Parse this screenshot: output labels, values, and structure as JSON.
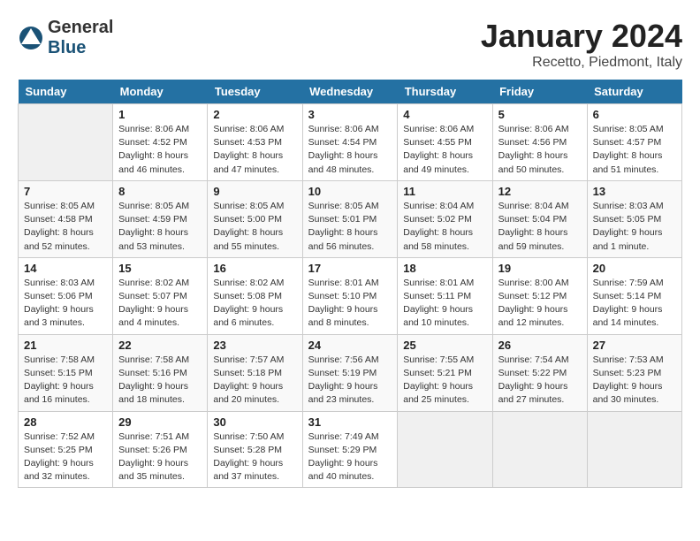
{
  "header": {
    "logo": {
      "general": "General",
      "blue": "Blue"
    },
    "title": "January 2024",
    "subtitle": "Recetto, Piedmont, Italy"
  },
  "days_of_week": [
    "Sunday",
    "Monday",
    "Tuesday",
    "Wednesday",
    "Thursday",
    "Friday",
    "Saturday"
  ],
  "weeks": [
    [
      {
        "day": null,
        "empty": true
      },
      {
        "day": 1,
        "sunrise": "8:06 AM",
        "sunset": "4:52 PM",
        "daylight": "8 hours and 46 minutes."
      },
      {
        "day": 2,
        "sunrise": "8:06 AM",
        "sunset": "4:53 PM",
        "daylight": "8 hours and 47 minutes."
      },
      {
        "day": 3,
        "sunrise": "8:06 AM",
        "sunset": "4:54 PM",
        "daylight": "8 hours and 48 minutes."
      },
      {
        "day": 4,
        "sunrise": "8:06 AM",
        "sunset": "4:55 PM",
        "daylight": "8 hours and 49 minutes."
      },
      {
        "day": 5,
        "sunrise": "8:06 AM",
        "sunset": "4:56 PM",
        "daylight": "8 hours and 50 minutes."
      },
      {
        "day": 6,
        "sunrise": "8:05 AM",
        "sunset": "4:57 PM",
        "daylight": "8 hours and 51 minutes."
      }
    ],
    [
      {
        "day": 7,
        "sunrise": "8:05 AM",
        "sunset": "4:58 PM",
        "daylight": "8 hours and 52 minutes."
      },
      {
        "day": 8,
        "sunrise": "8:05 AM",
        "sunset": "4:59 PM",
        "daylight": "8 hours and 53 minutes."
      },
      {
        "day": 9,
        "sunrise": "8:05 AM",
        "sunset": "5:00 PM",
        "daylight": "8 hours and 55 minutes."
      },
      {
        "day": 10,
        "sunrise": "8:05 AM",
        "sunset": "5:01 PM",
        "daylight": "8 hours and 56 minutes."
      },
      {
        "day": 11,
        "sunrise": "8:04 AM",
        "sunset": "5:02 PM",
        "daylight": "8 hours and 58 minutes."
      },
      {
        "day": 12,
        "sunrise": "8:04 AM",
        "sunset": "5:04 PM",
        "daylight": "8 hours and 59 minutes."
      },
      {
        "day": 13,
        "sunrise": "8:03 AM",
        "sunset": "5:05 PM",
        "daylight": "9 hours and 1 minute."
      }
    ],
    [
      {
        "day": 14,
        "sunrise": "8:03 AM",
        "sunset": "5:06 PM",
        "daylight": "9 hours and 3 minutes."
      },
      {
        "day": 15,
        "sunrise": "8:02 AM",
        "sunset": "5:07 PM",
        "daylight": "9 hours and 4 minutes."
      },
      {
        "day": 16,
        "sunrise": "8:02 AM",
        "sunset": "5:08 PM",
        "daylight": "9 hours and 6 minutes."
      },
      {
        "day": 17,
        "sunrise": "8:01 AM",
        "sunset": "5:10 PM",
        "daylight": "9 hours and 8 minutes."
      },
      {
        "day": 18,
        "sunrise": "8:01 AM",
        "sunset": "5:11 PM",
        "daylight": "9 hours and 10 minutes."
      },
      {
        "day": 19,
        "sunrise": "8:00 AM",
        "sunset": "5:12 PM",
        "daylight": "9 hours and 12 minutes."
      },
      {
        "day": 20,
        "sunrise": "7:59 AM",
        "sunset": "5:14 PM",
        "daylight": "9 hours and 14 minutes."
      }
    ],
    [
      {
        "day": 21,
        "sunrise": "7:58 AM",
        "sunset": "5:15 PM",
        "daylight": "9 hours and 16 minutes."
      },
      {
        "day": 22,
        "sunrise": "7:58 AM",
        "sunset": "5:16 PM",
        "daylight": "9 hours and 18 minutes."
      },
      {
        "day": 23,
        "sunrise": "7:57 AM",
        "sunset": "5:18 PM",
        "daylight": "9 hours and 20 minutes."
      },
      {
        "day": 24,
        "sunrise": "7:56 AM",
        "sunset": "5:19 PM",
        "daylight": "9 hours and 23 minutes."
      },
      {
        "day": 25,
        "sunrise": "7:55 AM",
        "sunset": "5:21 PM",
        "daylight": "9 hours and 25 minutes."
      },
      {
        "day": 26,
        "sunrise": "7:54 AM",
        "sunset": "5:22 PM",
        "daylight": "9 hours and 27 minutes."
      },
      {
        "day": 27,
        "sunrise": "7:53 AM",
        "sunset": "5:23 PM",
        "daylight": "9 hours and 30 minutes."
      }
    ],
    [
      {
        "day": 28,
        "sunrise": "7:52 AM",
        "sunset": "5:25 PM",
        "daylight": "9 hours and 32 minutes."
      },
      {
        "day": 29,
        "sunrise": "7:51 AM",
        "sunset": "5:26 PM",
        "daylight": "9 hours and 35 minutes."
      },
      {
        "day": 30,
        "sunrise": "7:50 AM",
        "sunset": "5:28 PM",
        "daylight": "9 hours and 37 minutes."
      },
      {
        "day": 31,
        "sunrise": "7:49 AM",
        "sunset": "5:29 PM",
        "daylight": "9 hours and 40 minutes."
      },
      {
        "day": null,
        "empty": true
      },
      {
        "day": null,
        "empty": true
      },
      {
        "day": null,
        "empty": true
      }
    ]
  ]
}
